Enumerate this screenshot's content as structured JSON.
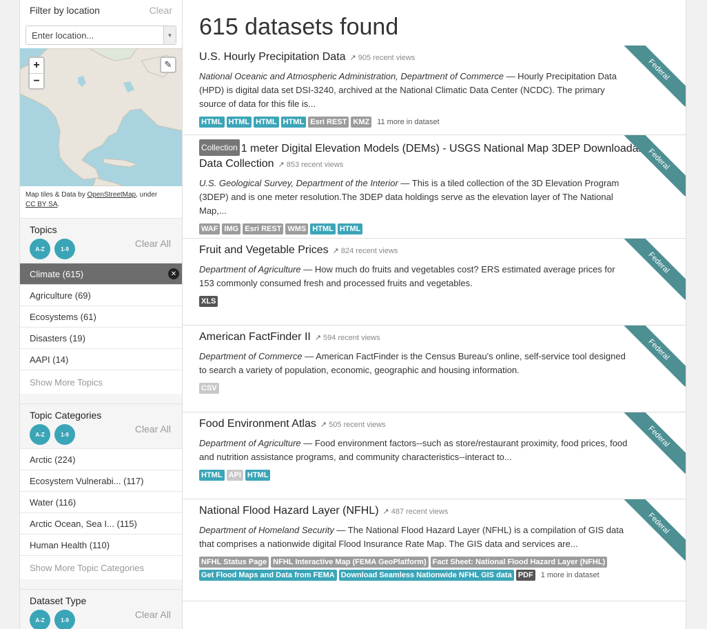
{
  "sidebar": {
    "location": {
      "title": "Filter by location",
      "clear": "Clear",
      "placeholder": "Enter location...",
      "attribution_prefix": "Map tiles & Data by ",
      "osm_link": "OpenStreetMap",
      "attribution_mid": ", under",
      "license_link": "CC BY SA",
      "attribution_suffix": "."
    },
    "topics": {
      "title": "Topics",
      "sort_az": "A-Z",
      "sort_count": "1-9",
      "clear_all": "Clear All",
      "items": [
        {
          "label": "Climate (615)"
        },
        {
          "label": "Agriculture (69)"
        },
        {
          "label": "Ecosystems (61)"
        },
        {
          "label": "Disasters (19)"
        },
        {
          "label": "AAPI (14)"
        }
      ],
      "show_more": "Show More Topics"
    },
    "topic_categories": {
      "title": "Topic Categories",
      "sort_az": "A-Z",
      "sort_count": "1-9",
      "clear_all": "Clear All",
      "items": [
        {
          "label": "Arctic (224)"
        },
        {
          "label": "Ecosystem Vulnerabi... (117)"
        },
        {
          "label": "Water (116)"
        },
        {
          "label": "Arctic Ocean, Sea I... (115)"
        },
        {
          "label": "Human Health (110)"
        }
      ],
      "show_more": "Show More Topic Categories"
    },
    "dataset_type": {
      "title": "Dataset Type",
      "sort_az": "A-Z",
      "sort_count": "1-9",
      "clear_all": "Clear All"
    }
  },
  "main": {
    "title": "615 datasets found",
    "results": [
      {
        "title": "U.S. Hourly Precipitation Data",
        "views": "905 recent views",
        "org": "National Oceanic and Atmospheric Administration, Department of Commerce",
        "desc": " — Hourly Precipitation Data (HPD) is digital data set DSI-3240, archived at the National Climatic Data Center (NCDC). The primary source of data for this file is...",
        "tags": [
          "HTML",
          "HTML",
          "HTML",
          "HTML",
          "Esri REST",
          "KMZ"
        ],
        "more": "11 more in dataset",
        "ribbon": "Federal"
      },
      {
        "badge": "Collection",
        "title": "1 meter Digital Elevation Models (DEMs) - USGS National Map 3DEP Downloadable Data Collection",
        "views": "853 recent views",
        "org": "U.S. Geological Survey, Department of the Interior",
        "desc": " — This is a tiled collection of the 3D Elevation Program (3DEP) and is one meter resolution.The 3DEP data holdings serve as the elevation layer of The National Map,...",
        "tags": [
          "WAF",
          "IMG",
          "Esri REST",
          "WMS",
          "HTML",
          "HTML"
        ],
        "ribbon": "Federal"
      },
      {
        "title": "Fruit and Vegetable Prices",
        "views": "824 recent views",
        "org": "Department of Agriculture",
        "desc": " — How much do fruits and vegetables cost? ERS estimated average prices for 153 commonly consumed fresh and processed fruits and vegetables.",
        "tags": [
          "XLS"
        ],
        "ribbon": "Federal"
      },
      {
        "title": "American FactFinder II",
        "views": "594 recent views",
        "org": "Department of Commerce",
        "desc": " — American FactFinder is the Census Bureau's online, self-service tool designed to search a variety of population, economic, geographic and housing information.",
        "tags": [
          "CSV"
        ],
        "ribbon": "Federal"
      },
      {
        "title": "Food Environment Atlas",
        "views": "505 recent views",
        "org": "Department of Agriculture",
        "desc": " — Food environment factors--such as store/restaurant proximity, food prices, food and nutrition assistance programs, and community characteristics--interact to...",
        "tags": [
          "HTML",
          "API",
          "HTML"
        ],
        "ribbon": "Federal"
      },
      {
        "title": "National Flood Hazard Layer (NFHL)",
        "views": "487 recent views",
        "org": "Department of Homeland Security",
        "desc": " — The National Flood Hazard Layer (NFHL) is a compilation of GIS data that comprises a nationwide digital Flood Insurance Rate Map. The GIS data and services are...",
        "tags": [
          "NFHL Status Page",
          "NFHL Interactive Map (FEMA GeoPlatform)",
          "Fact Sheet: National Flood Hazard Layer (NFHL)",
          "Get Flood Maps and Data from FEMA",
          "Download Seamless Nationwide NFHL GIS data",
          "PDF"
        ],
        "more": "1 more in dataset",
        "ribbon": "Federal"
      }
    ]
  },
  "icons": {
    "zoom_in": "+",
    "zoom_out": "−",
    "pencil": "✎",
    "remove": "✕",
    "trend": "📈"
  }
}
